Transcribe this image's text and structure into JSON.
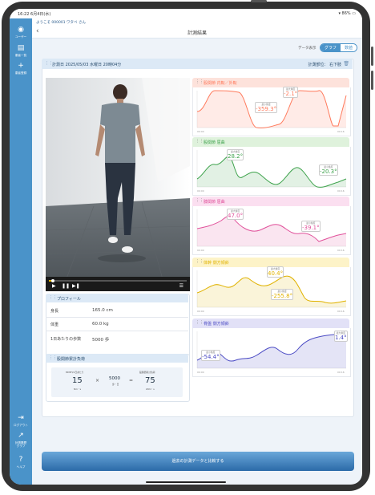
{
  "status": {
    "time": "16:22",
    "date": "6月4日(水)",
    "signal": "WiFi",
    "battery": "86%"
  },
  "welcome": "ようこそ 000001 ワタベ さん",
  "page_title": "計測結果",
  "sidebar": {
    "items": [
      {
        "label": "ユーザー",
        "icon": "user-icon"
      },
      {
        "label": "患者一覧",
        "icon": "list-icon"
      },
      {
        "label": "患者登録",
        "icon": "plus-icon"
      },
      {
        "label": "ログアウト",
        "icon": "logout-icon"
      },
      {
        "label": "計測履歴\nグラフ",
        "icon": "chart-icon"
      },
      {
        "label": "ヘルプ",
        "icon": "help-icon"
      }
    ]
  },
  "display_toggle": {
    "label": "データ表示",
    "graph": "グラフ",
    "numeric": "数値"
  },
  "session": {
    "title": "計測日  2025/05/03  水曜日  20時04分",
    "part": "計測部位：  右下肢"
  },
  "panels": [
    {
      "title": "股関節  内転／外転",
      "color": "#ff7a5c",
      "bg": "#fde2db",
      "max_val": "-2.1°",
      "min_val": "-359.3°",
      "max_cap": "最大角度",
      "min_cap": "最小角度",
      "t0": "00:00",
      "t1": "00:16"
    },
    {
      "title": "股関節  屈曲",
      "color": "#3fa34d",
      "bg": "#dff2dc",
      "max_val": "28.2°",
      "min_val": "-20.3°",
      "max_cap": "最大角度",
      "min_cap": "最小角度",
      "t0": "00:00",
      "t1": "00:16"
    },
    {
      "title": "膝関節  屈曲",
      "color": "#e0509a",
      "bg": "#fbdff0",
      "max_val": "47.0°",
      "min_val": "-39.1°",
      "max_cap": "最大角度",
      "min_cap": "最小角度",
      "t0": "00:00",
      "t1": "00:16"
    },
    {
      "title": "体幹  側方傾斜",
      "color": "#e0b200",
      "bg": "#fdf3c8",
      "max_val": "40.4°",
      "min_val": "-255.8°",
      "max_cap": "最大角度",
      "min_cap": "最小角度",
      "t0": "00:00",
      "t1": "00:16"
    },
    {
      "title": "骨盤  側方傾斜",
      "color": "#4b4bc4",
      "bg": "#e2e1f7",
      "max_val": "1.4°",
      "min_val": "-54.4°",
      "max_cap": "最大角度",
      "min_cap": "最小角度",
      "t0": "00:00",
      "t1": "00:16"
    }
  ],
  "profile": {
    "title": "プロフィール",
    "rows": [
      {
        "label": "身長",
        "value": "165.0",
        "unit": "cm"
      },
      {
        "label": "体重",
        "value": "60.0",
        "unit": "kg"
      },
      {
        "label": "1日あたりの歩数",
        "value": "5000",
        "unit": "歩"
      }
    ]
  },
  "hip_load": {
    "title": "股関節累計負荷",
    "a_cap": "MMPH/1日あたり",
    "a": "15",
    "a_unit": "Nm・s",
    "op1": "×",
    "b": "5000",
    "b_unit": "歩・日",
    "op2": "=",
    "c_cap": "股関節累計負荷",
    "c": "75",
    "c_unit": "kNm・s"
  },
  "compare_button": "過去の計測データと比較する"
}
